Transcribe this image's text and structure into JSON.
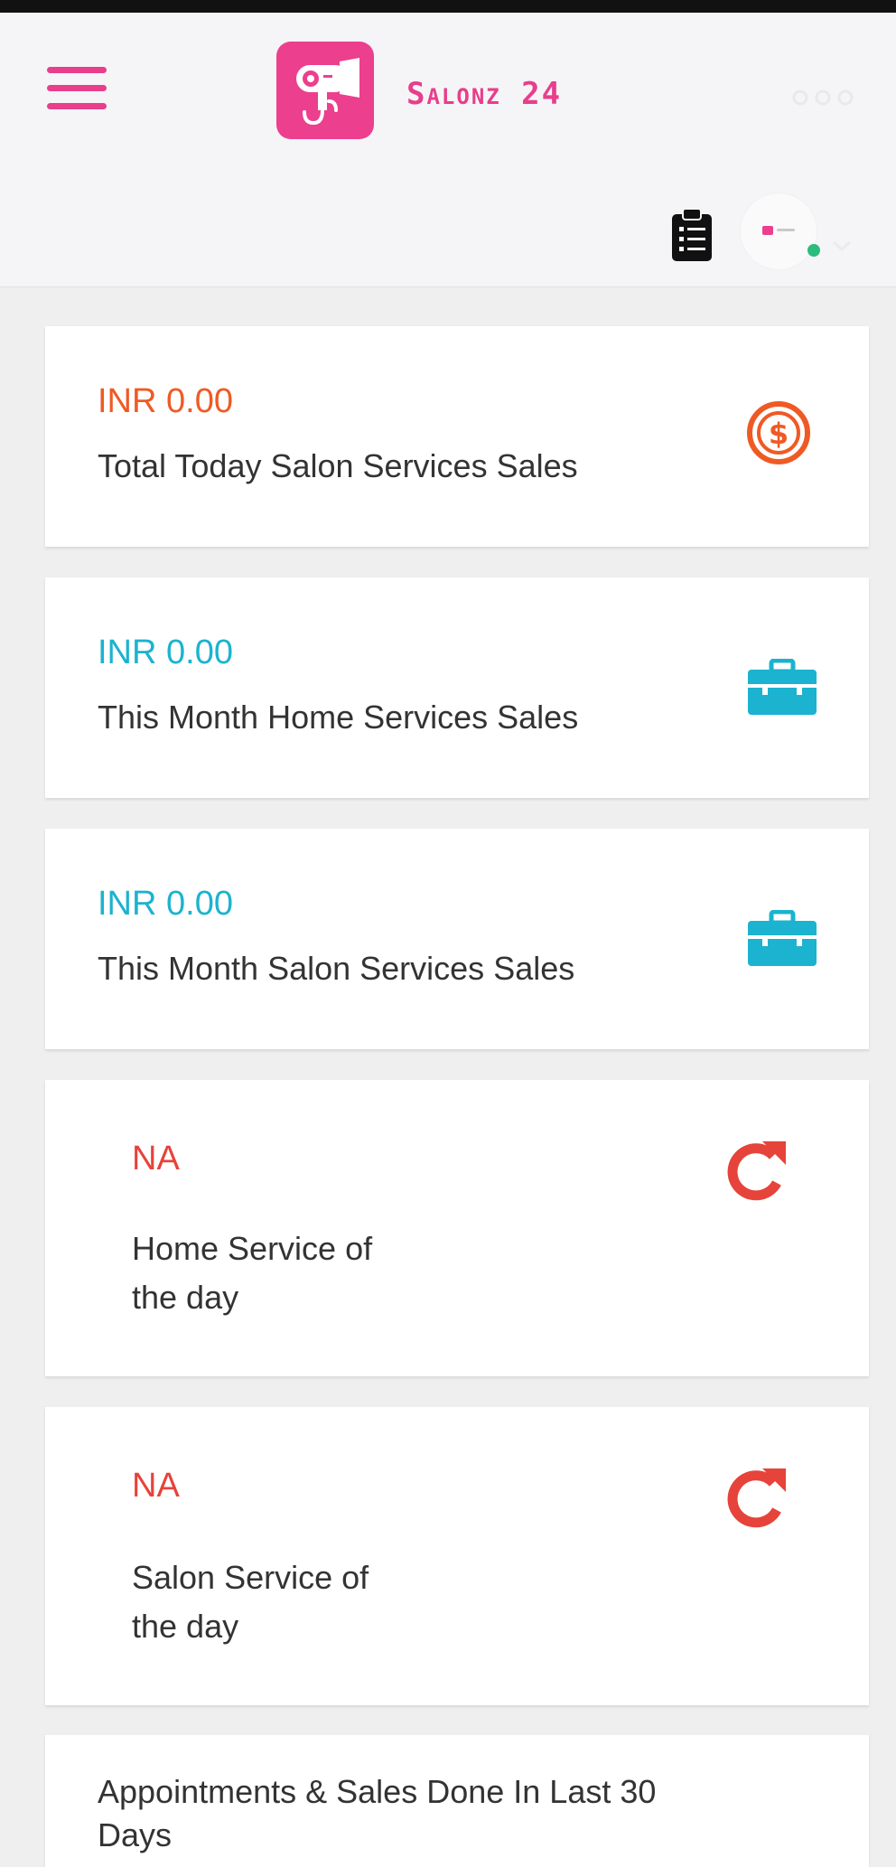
{
  "header": {
    "brand": "Salonz 24"
  },
  "cards": [
    {
      "amount": "INR 0.00",
      "label": "Total Today Salon Services Sales",
      "icon": "dollar-circle-icon",
      "color": "#ef5a24"
    },
    {
      "amount": "INR 0.00",
      "label": "This Month Home Services Sales",
      "icon": "briefcase-icon",
      "color": "#1bb3cf"
    },
    {
      "amount": "INR 0.00",
      "label": "This Month Salon Services Sales",
      "icon": "briefcase-icon",
      "color": "#1bb3cf"
    },
    {
      "amount": "NA",
      "label_line1": "Home Service of",
      "label_line2": "the day",
      "icon": "refresh-icon",
      "color": "#e6433a"
    },
    {
      "amount": "NA",
      "label_line1": "Salon Service of",
      "label_line2": "the day",
      "icon": "refresh-icon",
      "color": "#e6433a"
    }
  ],
  "appointments_card": {
    "title_line1": "Appointments & Sales Done In Last 30",
    "title_line2": "Days"
  },
  "colors": {
    "brand_pink": "#e83e8c",
    "orange": "#ef5a24",
    "teal": "#1bb3cf",
    "red": "#e6433a",
    "online_green": "#2bbd7e"
  }
}
